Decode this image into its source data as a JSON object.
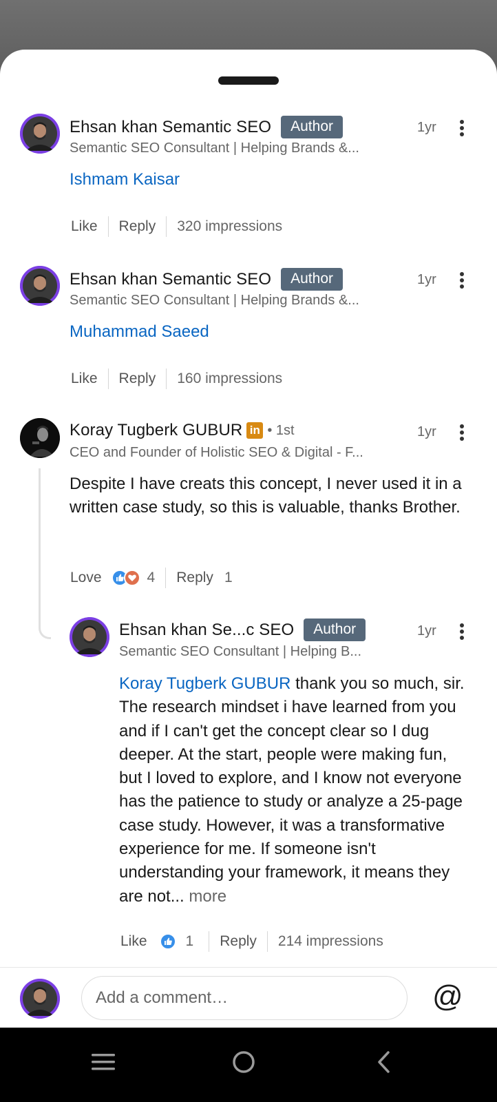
{
  "comments": [
    {
      "name": "Ehsan khan Semantic SEO",
      "badge": "Author",
      "headline": "Semantic SEO Consultant | Helping Brands &...",
      "time": "1yr",
      "mention": "Ishmam Kaisar",
      "like_label": "Like",
      "reply_label": "Reply",
      "impressions": "320 impressions"
    },
    {
      "name": "Ehsan khan Semantic SEO",
      "badge": "Author",
      "headline": "Semantic SEO Consultant | Helping Brands &...",
      "time": "1yr",
      "mention": "Muhammad Saeed",
      "like_label": "Like",
      "reply_label": "Reply",
      "impressions": "160 impressions"
    },
    {
      "name": "Koray Tugberk GUBUR",
      "li_badge": "in",
      "degree": "• 1st",
      "headline": "CEO and Founder of Holistic SEO & Digital - F...",
      "time": "1yr",
      "text": "Despite I have creats this concept, I never used it in a written case study, so this is valuable, thanks Brother.",
      "reaction_label": "Love",
      "reaction_count": "4",
      "reply_label": "Reply",
      "reply_count": "1"
    }
  ],
  "reply": {
    "name": "Ehsan khan Se...c SEO",
    "badge": "Author",
    "headline": "Semantic SEO Consultant | Helping B...",
    "time": "1yr",
    "mention": "Koray Tugberk GUBUR",
    "text": " thank you so much, sir. The research mindset i have learned from you  and if I can't get the concept clear so I dug deeper. At the start, people were making fun, but I loved to explore, and I know not everyone has the patience to study or analyze a 25-page case study. However, it was a transformative experience for me. If someone isn't understanding your framework, it means they are not...",
    "more_label": " more",
    "like_label": "Like",
    "reaction_count": "1",
    "reply_label": "Reply",
    "impressions": "214 impressions"
  },
  "composer": {
    "placeholder": "Add a comment…",
    "at_symbol": "@"
  },
  "colors": {
    "link": "#0a66c2",
    "author_badge": "#56687a",
    "love": "#b24020",
    "avatar_ring": "#7b3fe4"
  },
  "icons": [
    "kebab-menu-icon",
    "like-reaction-icon",
    "love-reaction-icon",
    "mention-at-icon",
    "nav-recents-icon",
    "nav-home-icon",
    "nav-back-icon"
  ]
}
